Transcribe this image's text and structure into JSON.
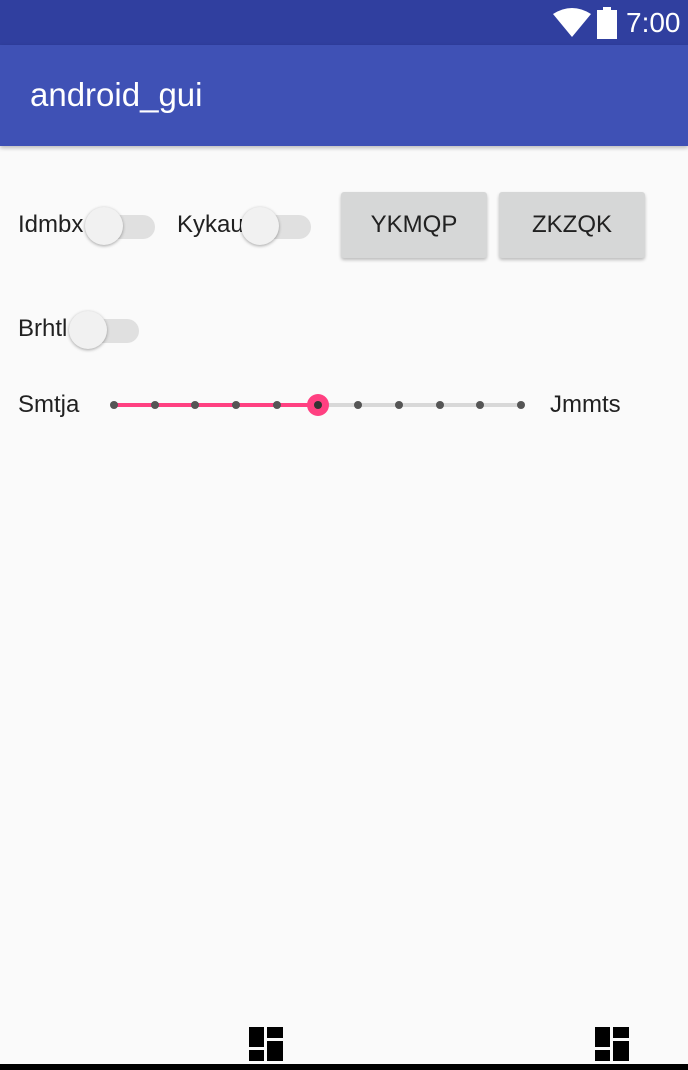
{
  "status_bar": {
    "time": "7:00",
    "icons": [
      "wifi-icon",
      "battery-icon"
    ],
    "color": "#303f9f"
  },
  "app_bar": {
    "title": "android_gui",
    "color": "#3f51b5"
  },
  "switches": [
    {
      "label": "Idmbx",
      "checked": false
    },
    {
      "label": "Kykau",
      "checked": false
    },
    {
      "label": "Brhtl",
      "checked": false
    }
  ],
  "buttons": [
    {
      "label": "YKMQP"
    },
    {
      "label": "ZKZQK"
    }
  ],
  "seekbar": {
    "left_label": "Smtja",
    "right_label": "Jmmts",
    "max": 10,
    "value": 5,
    "accent": "#ff4081"
  },
  "bottom_nav": {
    "icons": [
      "dashboard-icon",
      "dashboard-icon"
    ]
  }
}
